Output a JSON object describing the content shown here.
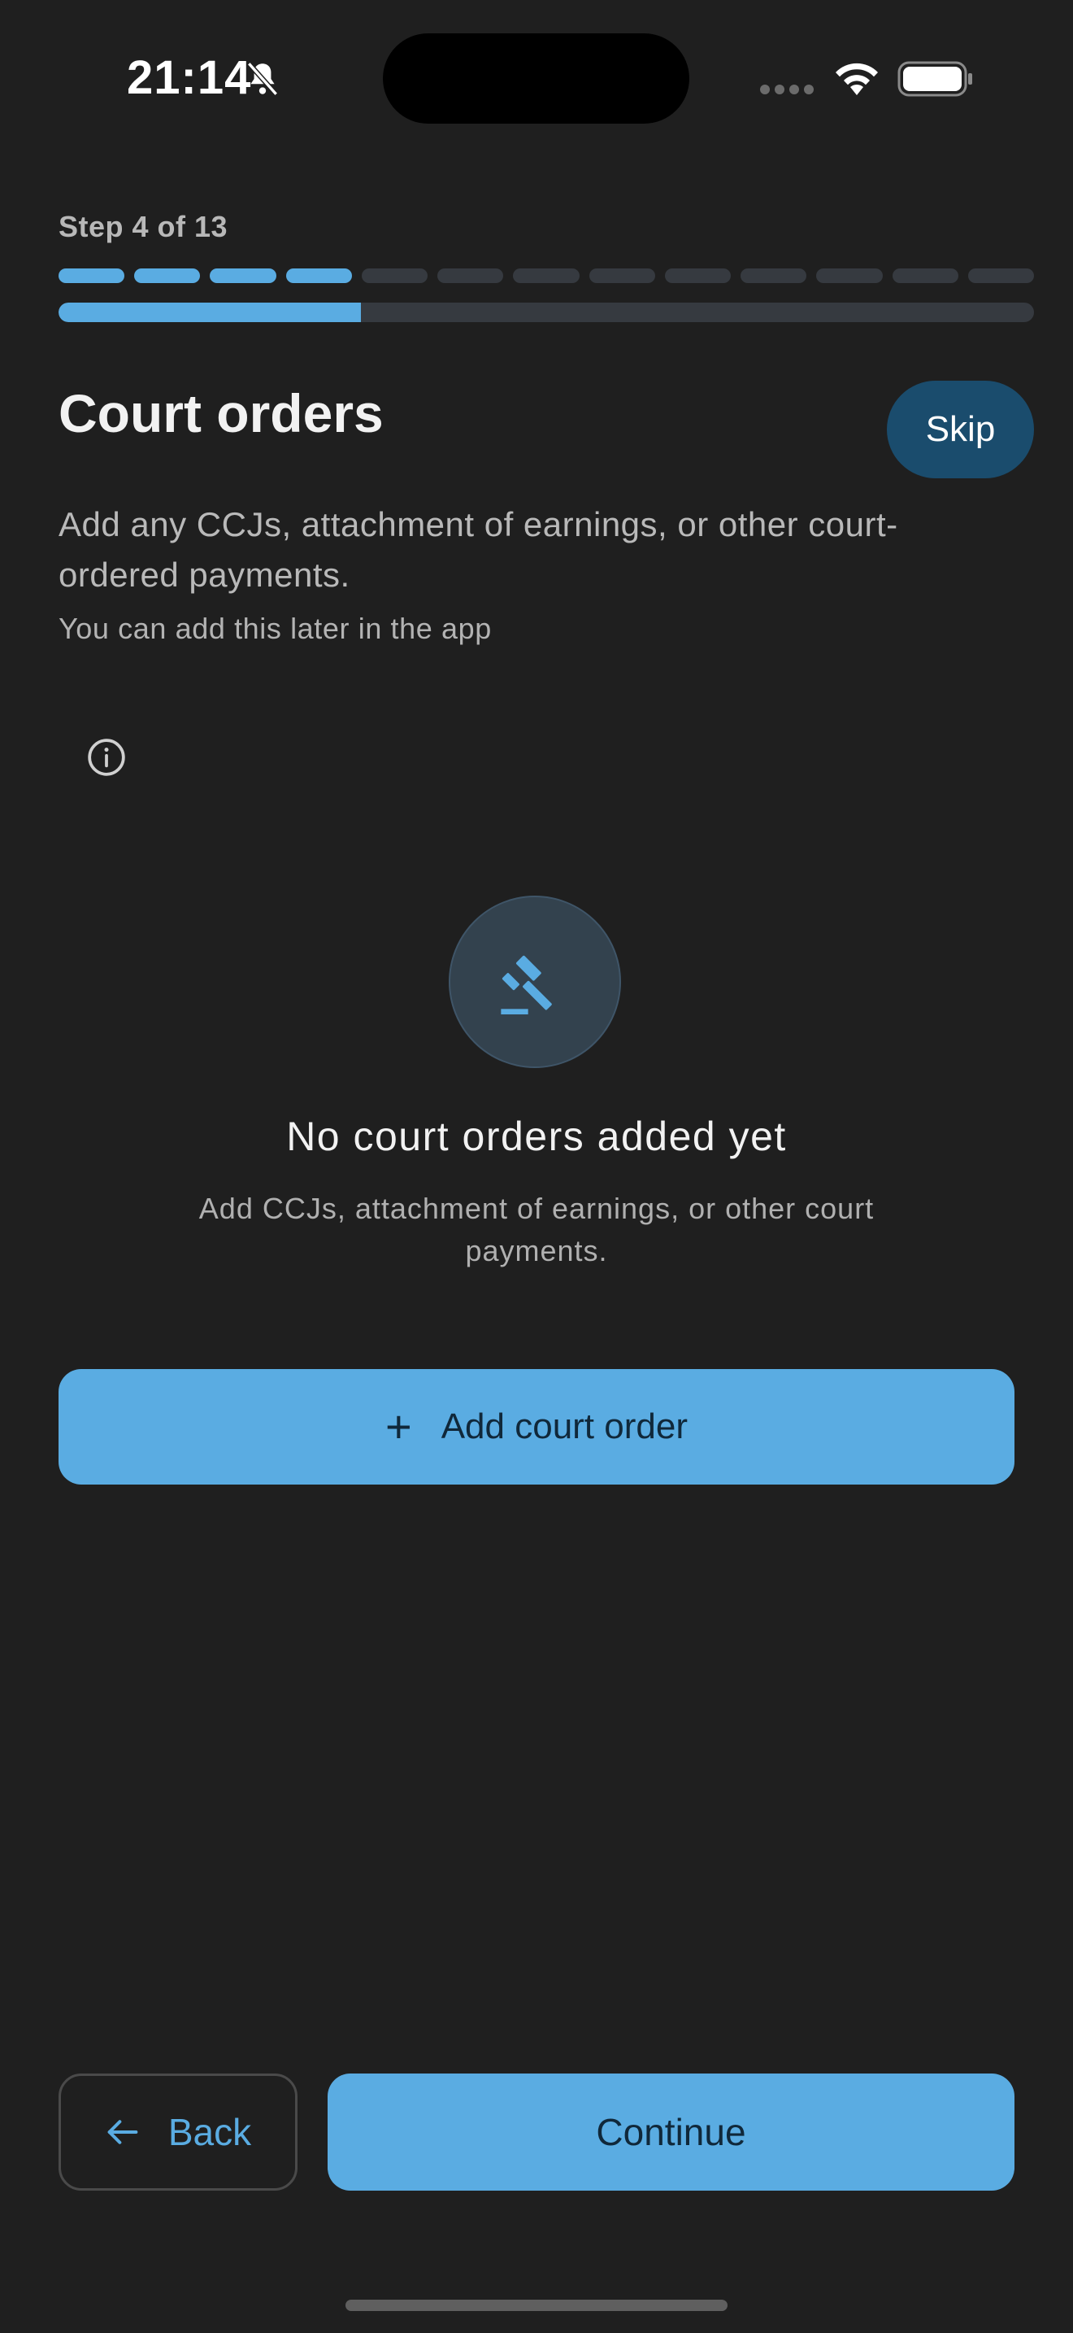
{
  "status_bar": {
    "time": "21:14",
    "icons": [
      "bell-slash-icon",
      "signal-icon",
      "wifi-icon",
      "battery-icon"
    ]
  },
  "progress": {
    "step_label": "Step 4 of 13",
    "current_step": 4,
    "total_steps": 13,
    "bar_fraction": 0.31
  },
  "header": {
    "title": "Court orders",
    "skip_label": "Skip"
  },
  "intro": {
    "description": "Add any CCJs, attachment of earnings, or other court-ordered payments.",
    "hint": "You can add this later in the app"
  },
  "empty_state": {
    "icon": "gavel-icon",
    "title": "No court orders added yet",
    "description": "Add CCJs, attachment of earnings, or other court payments."
  },
  "actions": {
    "add_label": "Add court order",
    "back_label": "Back",
    "continue_label": "Continue"
  },
  "colors": {
    "background": "#1f1f1f",
    "accent": "#5aace2",
    "skip_bg": "#1a4c6d",
    "track": "#363a40"
  }
}
